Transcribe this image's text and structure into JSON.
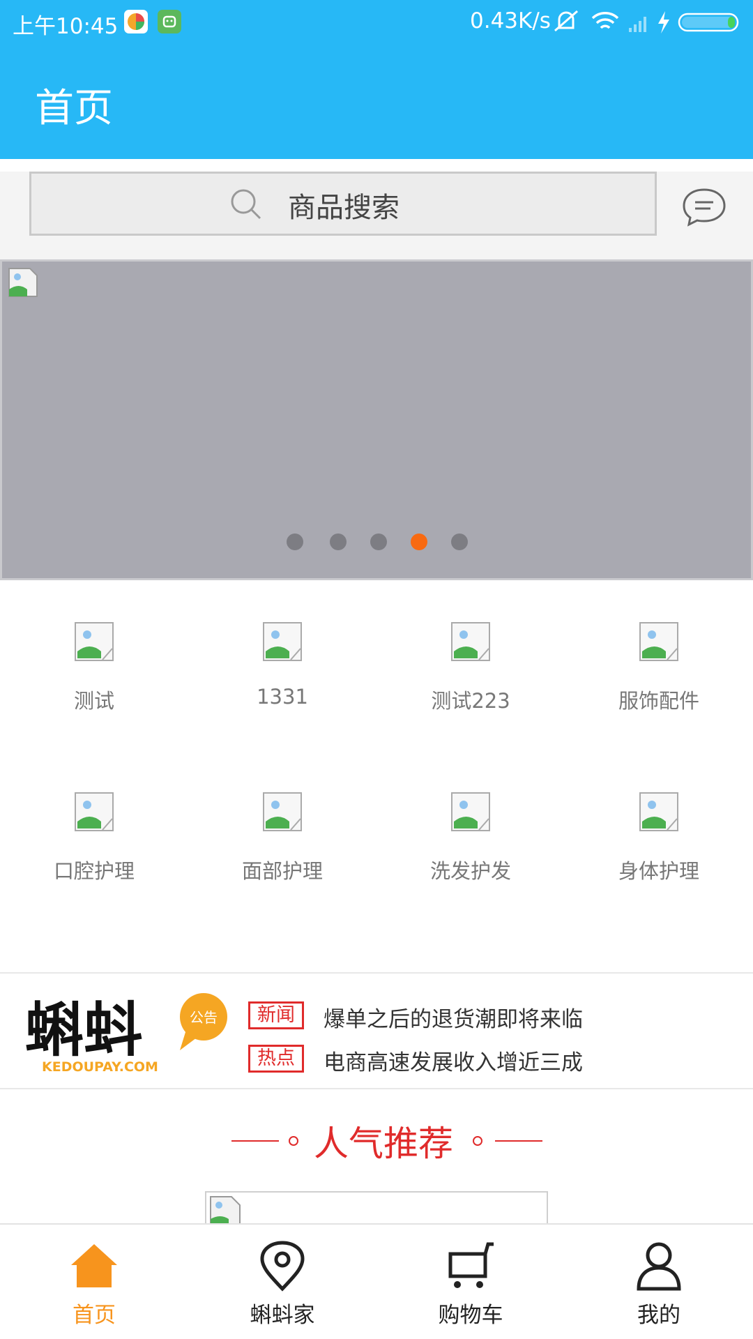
{
  "status_bar": {
    "time": "上午10:45",
    "net_speed": "0.43K/s"
  },
  "header": {
    "title": "首页"
  },
  "search": {
    "placeholder": "商品搜索",
    "icon": "search-icon",
    "message_icon": "message-icon"
  },
  "banner": {
    "dots": 5,
    "active_dot": 4,
    "active_color": "#f86a11"
  },
  "categories": [
    {
      "label": "测试"
    },
    {
      "label": "1331"
    },
    {
      "label": "测试223"
    },
    {
      "label": "服饰配件"
    },
    {
      "label": "口腔护理"
    },
    {
      "label": "面部护理"
    },
    {
      "label": "洗发护发"
    },
    {
      "label": "身体护理"
    }
  ],
  "notice": {
    "logo_text": "蝌蚪",
    "logo_badge": "公告",
    "logo_domain": "KEDOUPAY.COM",
    "items": [
      {
        "tag": "新闻",
        "text": "爆单之后的退货潮即将来临"
      },
      {
        "tag": "热点",
        "text": "电商高速发展收入增近三成"
      }
    ]
  },
  "recommend": {
    "title": "人气推荐"
  },
  "bottom_nav": {
    "items": [
      {
        "label": "首页",
        "icon": "home-icon",
        "active": true
      },
      {
        "label": "蝌蚪家",
        "icon": "location-pin-icon",
        "active": false
      },
      {
        "label": "购物车",
        "icon": "cart-icon",
        "active": false
      },
      {
        "label": "我的",
        "icon": "profile-icon",
        "active": false
      }
    ]
  },
  "colors": {
    "primary": "#27b8f6",
    "accent": "#f7941d",
    "red": "#e02b2b"
  }
}
